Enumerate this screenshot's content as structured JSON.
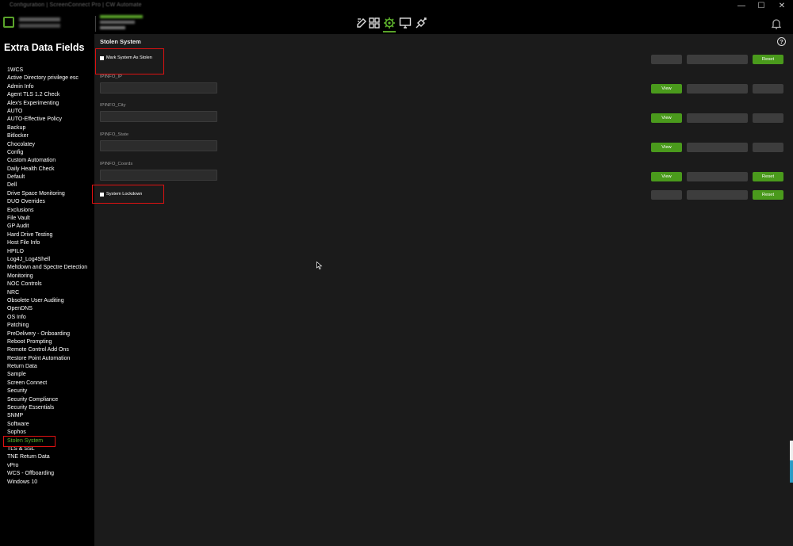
{
  "window": {
    "title": "Configuration | ScreenConnect Pro | CW Automate",
    "minimize": "—",
    "maximize": "☐",
    "close": "✕"
  },
  "header": {
    "icons": [
      "edit-icon",
      "grid-icon",
      "gear-icon",
      "monitor-icon",
      "plugin-icon"
    ],
    "active_icon": "gear-icon",
    "bell_icon": "bell-icon"
  },
  "sidebar": {
    "title": "Extra Data Fields",
    "items": [
      "1WCS",
      "Active Directory privilege esc",
      "Admin Info",
      "Agent TLS 1.2 Check",
      "Alex's Experimenting",
      "AUTO",
      "AUTO-Effective Policy",
      "Backup",
      "Bitlocker",
      "Chocolatey",
      "Config",
      "Custom Automation",
      "Daily Health Check",
      "Default",
      "Dell",
      "Drive Space Monitoring",
      "DUO Overrides",
      "Exclusions",
      "File Vault",
      "GP Audit",
      "Hard Drive Testing",
      "Host File Info",
      "HPILO",
      "Log4J_Log4Shell",
      "Meltdown and Spectre Detection",
      "Monitoring",
      "NOC Controls",
      "NRC",
      "Obsolete User Auditing",
      "OpenDNS",
      "OS Info",
      "Patching",
      "PreDelivery - Onboarding",
      "Reboot Prompting",
      "Remote Control Add Ons",
      "Restore Point Automation",
      "Return Data",
      "Sample",
      "Screen Connect",
      "Security",
      "Security Compliance",
      "Security Essentials",
      "SNMP",
      "Software",
      "Sophos",
      "Stolen System",
      "TLS & SSL",
      "TNE Return Data",
      "vPro",
      "WCS - Offboarding",
      "Windows 10"
    ],
    "active_item": "Stolen System"
  },
  "main": {
    "title": "Stolen System",
    "help": "?",
    "mark_stolen": {
      "label": "Mark System As Stolen",
      "reset": "Reset"
    },
    "fields": [
      {
        "label": "IPINFO_IP",
        "value": "",
        "view": "View"
      },
      {
        "label": "IPINFO_City",
        "value": "",
        "view": "View"
      },
      {
        "label": "IPINFO_State",
        "value": "",
        "view": "View"
      },
      {
        "label": "IPINFO_Coords",
        "value": "",
        "view": "View",
        "reset": "Reset"
      }
    ],
    "lockdown": {
      "label": "System Lockdown",
      "reset": "Reset"
    }
  }
}
